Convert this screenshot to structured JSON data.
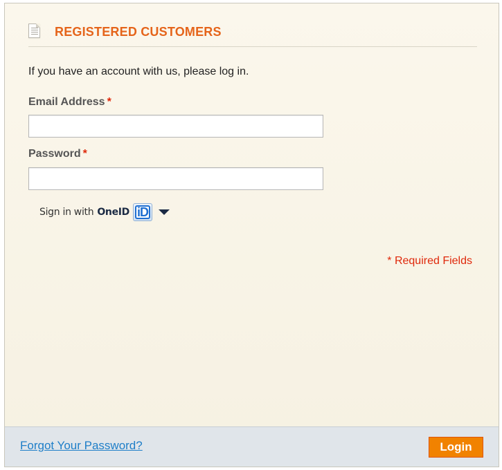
{
  "section": {
    "title": "REGISTERED CUSTOMERS",
    "icon": "document-icon"
  },
  "intro_text": "If you have an account with us, please log in.",
  "form": {
    "email": {
      "label": "Email Address",
      "required_mark": "*",
      "value": ""
    },
    "password": {
      "label": "Password",
      "required_mark": "*",
      "value": ""
    }
  },
  "oneid": {
    "prefix": "Sign in with",
    "brand": "OneID",
    "badge": "iD",
    "dropdown_icon": "caret-down-icon"
  },
  "required_note": "* Required Fields",
  "footer": {
    "forgot_link": "Forgot Your Password?",
    "login_label": "Login"
  },
  "colors": {
    "title": "#e5641a",
    "required": "#df280a",
    "link": "#1e7ec8",
    "button": "#f18200",
    "panel_background": "#f8f3e6",
    "footer_background": "#e0e5ea"
  }
}
